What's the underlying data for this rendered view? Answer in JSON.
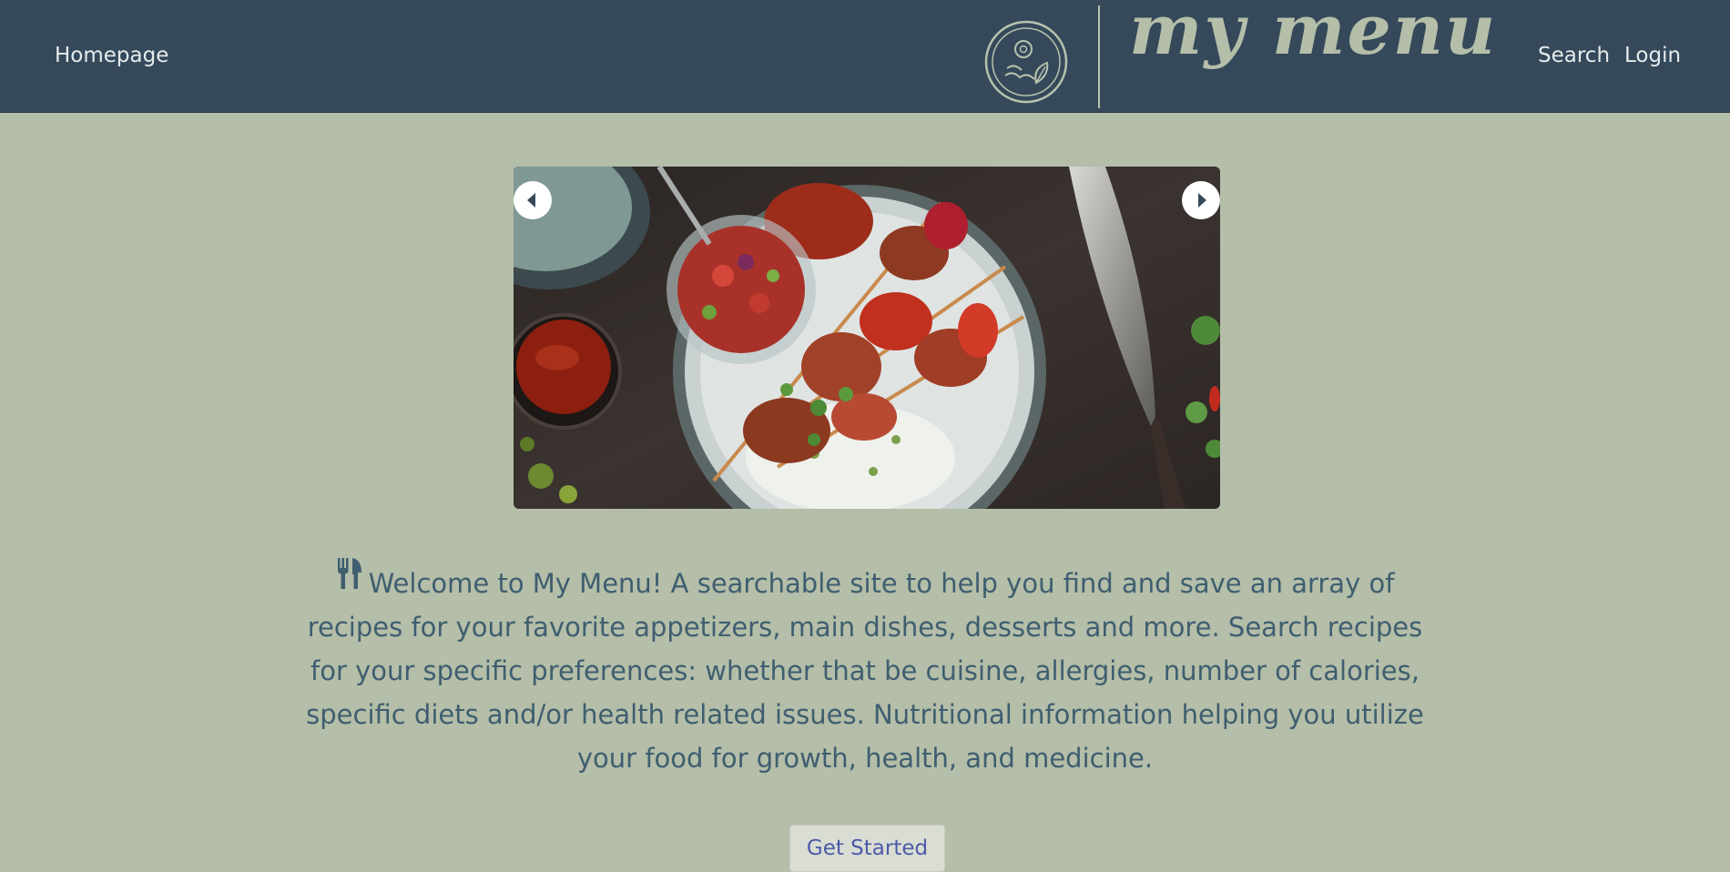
{
  "nav": {
    "home_label": "Homepage",
    "search_label": "Search",
    "login_label": "Login"
  },
  "logo": {
    "text": "my menu",
    "emblem_icon": "food-plate-emblem-icon"
  },
  "carousel": {
    "image_alt": "food-skewers-image",
    "prev_icon": "caret-left-icon",
    "next_icon": "caret-right-icon"
  },
  "intro": {
    "icon": "utensils-icon",
    "text": "Welcome to My Menu! A searchable site to help you find and save an array of recipes for your favorite appetizers, main dishes, desserts and more. Search recipes for your specific preferences: whether that be cuisine, allergies, number of calories, specific diets and/or health related issues. Nutritional information helping you utilize your food for growth, health, and medicine."
  },
  "cta": {
    "label": "Get Started"
  },
  "colors": {
    "navbar": "#35495b",
    "page_background": "#b4bea8",
    "intro_text": "#3f5e70",
    "logo_text": "#b4bea8"
  }
}
